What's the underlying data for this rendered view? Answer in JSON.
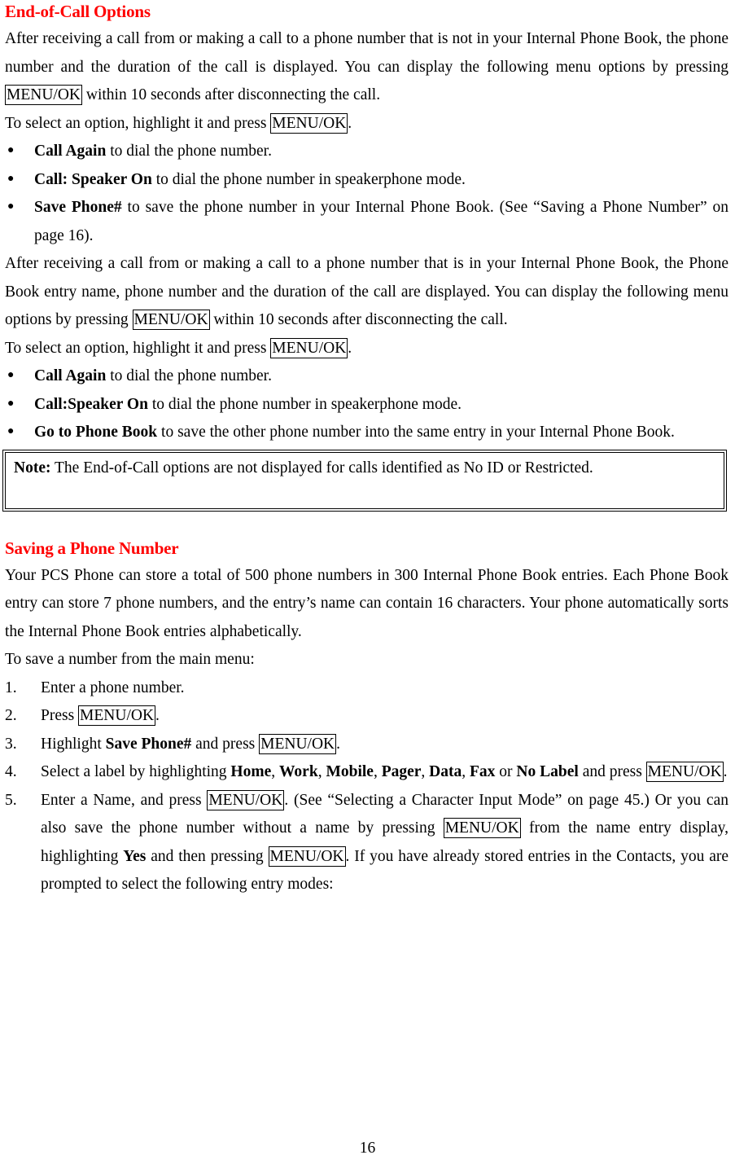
{
  "document": {
    "page_number": "16",
    "accent_color": "#FF0000",
    "text_color": "#000000",
    "key_label": "MENU/OK"
  },
  "section1": {
    "heading": "End-of-Call Options",
    "para1_a": "After receiving a call from or making a call to a phone number that is not in your Internal Phone Book, the phone number and the duration of the call is displayed. You can display the following menu options by pressing ",
    "para1_b": " within 10 seconds after disconnecting the call.",
    "para2_a": "To select an option, highlight it and press ",
    "para2_b": ".",
    "bullets": [
      {
        "label": "Call Again",
        "text": " to dial the phone number."
      },
      {
        "label": "Call: Speaker On",
        "text": " to dial the phone number in speakerphone mode."
      },
      {
        "label": "Save Phone#",
        "text": " to save the phone number in your Internal Phone Book. (See “Saving a Phone Number” on page 16)."
      }
    ],
    "para3_a": "After receiving a call from or making a call to a phone number that is in your Internal Phone Book, the Phone Book entry name, phone number and the duration of the call are displayed. You can display the following menu options by pressing ",
    "para3_b": " within 10 seconds after disconnecting the call.",
    "para4_a": "To select an option, highlight it and press ",
    "para4_b": ".",
    "bullets2": [
      {
        "label": "Call Again",
        "text": " to dial the phone number."
      },
      {
        "label": "Call:Speaker On",
        "text": " to dial the phone number in speakerphone mode."
      },
      {
        "label": "Go to Phone Book",
        "text": " to save the other phone number into the same entry in your Internal Phone Book."
      }
    ],
    "note": {
      "label": "Note:",
      "text": " The End-of-Call options are not displayed for calls identified as No ID or Restricted."
    }
  },
  "section2": {
    "heading": "Saving a Phone Number",
    "para1": "Your PCS Phone can store a total of 500 phone numbers in 300 Internal Phone Book entries. Each Phone Book entry can store 7 phone numbers, and the entry’s name can contain 16 characters. Your phone automatically sorts the Internal Phone Book entries alphabetically.",
    "para2": "To save a number from the main menu:",
    "steps": [
      {
        "num": "1.",
        "parts": [
          {
            "t": "text",
            "v": "Enter a phone number."
          }
        ]
      },
      {
        "num": "2.",
        "parts": [
          {
            "t": "text",
            "v": "Press "
          },
          {
            "t": "key",
            "v": "MENU/OK"
          },
          {
            "t": "text",
            "v": "."
          }
        ]
      },
      {
        "num": "3.",
        "parts": [
          {
            "t": "text",
            "v": "Highlight "
          },
          {
            "t": "bold",
            "v": "Save Phone#"
          },
          {
            "t": "text",
            "v": " and press "
          },
          {
            "t": "key",
            "v": "MENU/OK"
          },
          {
            "t": "text",
            "v": "."
          }
        ]
      },
      {
        "num": "4.",
        "parts": [
          {
            "t": "text",
            "v": "Select a label by highlighting "
          },
          {
            "t": "bold",
            "v": "Home"
          },
          {
            "t": "text",
            "v": ", "
          },
          {
            "t": "bold",
            "v": "Work"
          },
          {
            "t": "text",
            "v": ", "
          },
          {
            "t": "bold",
            "v": "Mobile"
          },
          {
            "t": "text",
            "v": ", "
          },
          {
            "t": "bold",
            "v": "Pager"
          },
          {
            "t": "text",
            "v": ", "
          },
          {
            "t": "bold",
            "v": "Data"
          },
          {
            "t": "text",
            "v": ", "
          },
          {
            "t": "bold",
            "v": "Fax"
          },
          {
            "t": "text",
            "v": " or "
          },
          {
            "t": "bold",
            "v": "No Label"
          },
          {
            "t": "text",
            "v": " and press "
          },
          {
            "t": "key",
            "v": "MENU/OK"
          },
          {
            "t": "text",
            "v": "."
          }
        ]
      },
      {
        "num": "5.",
        "parts": [
          {
            "t": "text",
            "v": "Enter a Name, and press "
          },
          {
            "t": "key",
            "v": "MENU/OK"
          },
          {
            "t": "text",
            "v": ". (See “Selecting a Character Input Mode” on page 45.) Or you can also save the phone number without a name by pressing "
          },
          {
            "t": "key",
            "v": "MENU/OK"
          },
          {
            "t": "text",
            "v": " from the name entry display, highlighting "
          },
          {
            "t": "bold",
            "v": "Yes"
          },
          {
            "t": "text",
            "v": " and then pressing "
          },
          {
            "t": "key",
            "v": "MENU/OK"
          },
          {
            "t": "text",
            "v": ". If you have already stored entries in the Contacts, you are prompted to select the following entry modes:"
          }
        ]
      }
    ]
  }
}
